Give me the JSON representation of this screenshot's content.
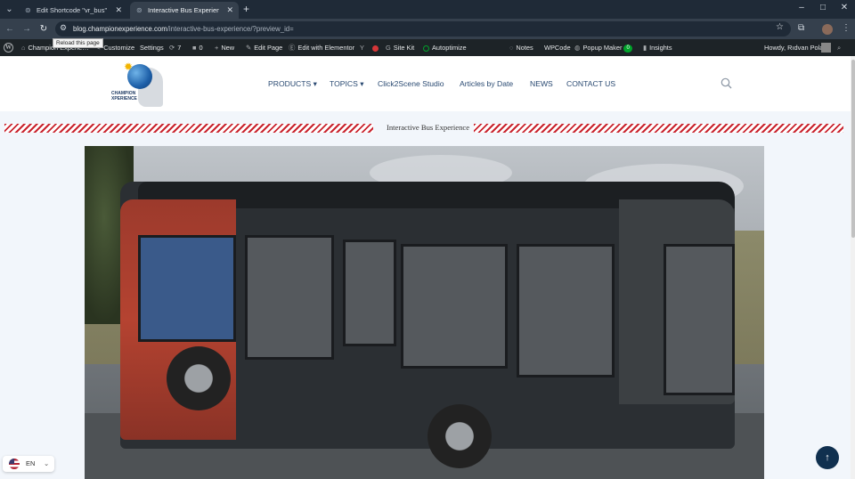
{
  "browser": {
    "tabs": [
      {
        "title": "Edit Shortcode \"vr_bus\" ‹ Champi…",
        "close": "✕"
      },
      {
        "title": "Interactive Bus Experience - Cham…",
        "close": "✕"
      }
    ],
    "new_tab": "+",
    "url_host": "blog.championexperience.com",
    "url_path": "/interactive-bus-experience/?preview_id=",
    "reload_tooltip": "Reload this page",
    "window_controls": [
      "–",
      "□",
      "✕"
    ]
  },
  "wp_admin_bar": {
    "site_name": "Champion Experie…",
    "customize": "Customize",
    "settings": "Settings",
    "updates_count": "7",
    "comments_count": "0",
    "new": "New",
    "edit_page": "Edit Page",
    "edit_elementor": "Edit with Elementor",
    "site_kit": "Site Kit",
    "autoptimize": "Autoptimize",
    "notes": "Notes",
    "wpcode": "WPCode",
    "popup_maker": "Popup Maker",
    "popup_badge": "0",
    "insights": "Insights",
    "howdy": "Howdy, Rıdvan Polat"
  },
  "site_header": {
    "logo_text_line1": "CHAMPION",
    "logo_text_line2": "XPERIENCE",
    "menu": [
      {
        "label": "PRODUCTS ▾"
      },
      {
        "label": "TOPICS ▾"
      },
      {
        "label": "Click2Scene Studio"
      },
      {
        "label": "Articles by Date"
      },
      {
        "label": "NEWS"
      },
      {
        "label": "CONTACT US"
      }
    ]
  },
  "page": {
    "title": "Interactive Bus Experience"
  },
  "language_switcher": {
    "code": "EN",
    "chevron": "⌄"
  },
  "scroll_top": "↑",
  "colors": {
    "accent_red": "#c9242e",
    "nav_blue": "#2a4a72",
    "wp_bar": "#1d2327",
    "scroll_top_bg": "#10304f"
  }
}
